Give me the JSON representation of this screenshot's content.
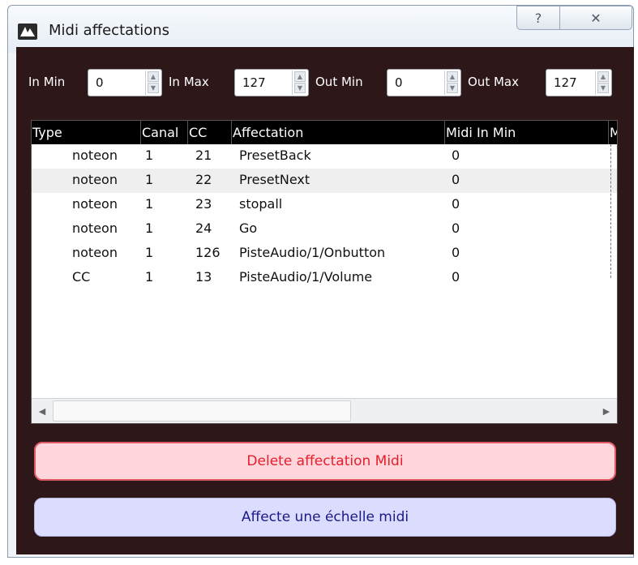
{
  "window": {
    "title": "Midi affectations",
    "help_label": "?",
    "close_label": "✕"
  },
  "ranges": {
    "in_min": {
      "label": "In Min",
      "value": "0"
    },
    "in_max": {
      "label": "In Max",
      "value": "127"
    },
    "out_min": {
      "label": "Out Min",
      "value": "0"
    },
    "out_max": {
      "label": "Out Max",
      "value": "127"
    }
  },
  "table": {
    "columns": [
      "Type",
      "Canal",
      "CC",
      "Affectation",
      "Midi In Min",
      "M"
    ],
    "rows": [
      {
        "type": "noteon",
        "canal": "1",
        "cc": "21",
        "affectation": "PresetBack",
        "midi_in_min": "0"
      },
      {
        "type": "noteon",
        "canal": "1",
        "cc": "22",
        "affectation": "PresetNext",
        "midi_in_min": "0"
      },
      {
        "type": "noteon",
        "canal": "1",
        "cc": "23",
        "affectation": "stopall",
        "midi_in_min": "0"
      },
      {
        "type": "noteon",
        "canal": "1",
        "cc": "24",
        "affectation": "Go",
        "midi_in_min": "0"
      },
      {
        "type": "noteon",
        "canal": "1",
        "cc": "126",
        "affectation": "PisteAudio/1/Onbutton",
        "midi_in_min": "0"
      },
      {
        "type": "CC",
        "canal": "1",
        "cc": "13",
        "affectation": "PisteAudio/1/Volume",
        "midi_in_min": "0"
      }
    ]
  },
  "buttons": {
    "delete_label": "Delete affectation Midi",
    "affecte_label": "Affecte une échelle midi"
  },
  "colors": {
    "client_bg": "#2e1719",
    "delete_bg": "#ffd6dc",
    "delete_text": "#e61e2b",
    "affecte_bg": "#dcdcff",
    "header_bg": "#000000"
  },
  "icons": {
    "app": "app-logo-icon",
    "help": "question-icon",
    "close": "close-icon",
    "spin_up": "arrow-up-icon",
    "spin_down": "arrow-down-icon",
    "scroll_left": "scroll-left-icon",
    "scroll_right": "scroll-right-icon"
  }
}
